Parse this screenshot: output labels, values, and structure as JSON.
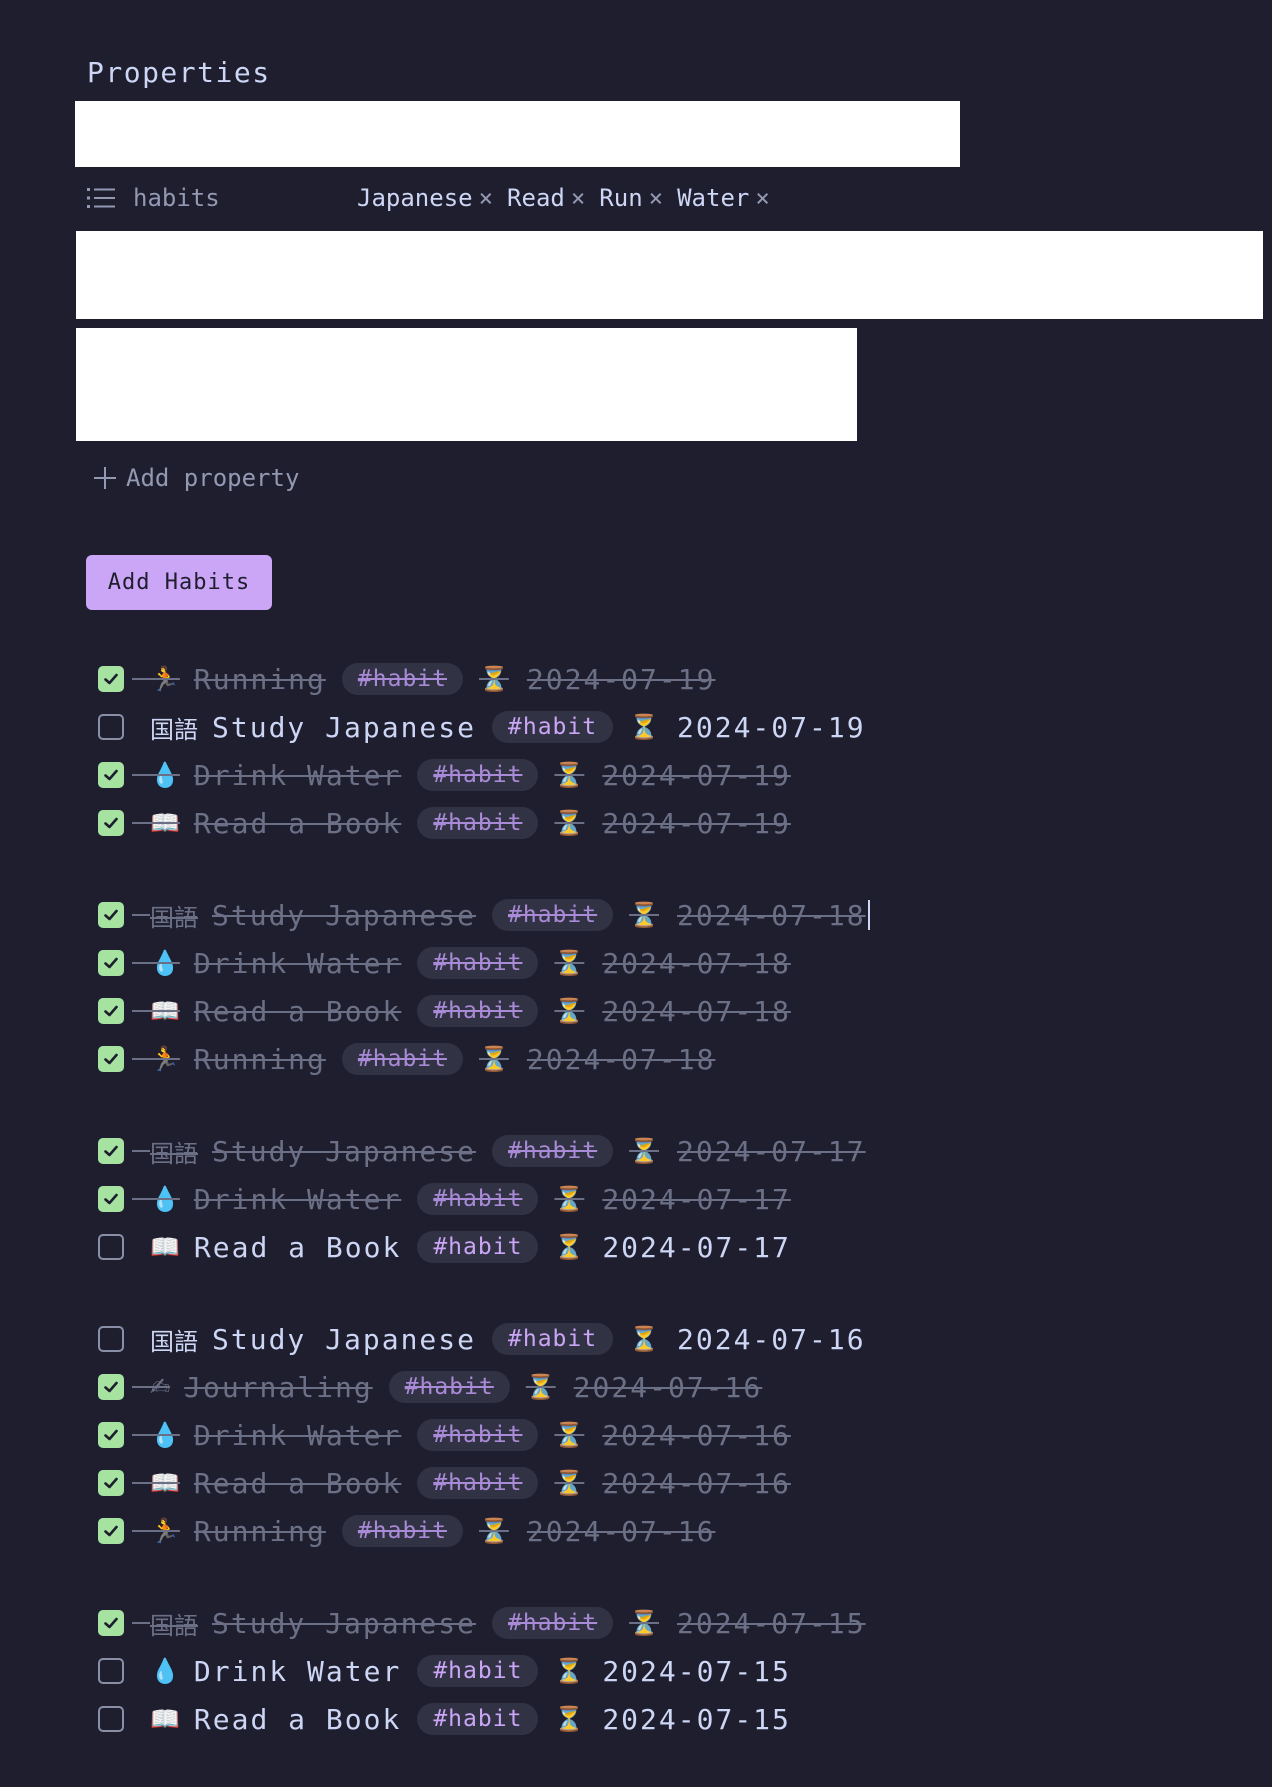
{
  "properties": {
    "title": "Properties",
    "habits_key": "habits",
    "habits_values": [
      "Japanese",
      "Read",
      "Run",
      "Water"
    ],
    "remove_glyph": "×",
    "add_property": "Add property"
  },
  "add_habits_button": "Add Habits",
  "tag_label": "#habit",
  "hourglass": "⏳",
  "groups": [
    {
      "tasks": [
        {
          "done": true,
          "emoji": "🏃",
          "name": "Running",
          "date": "2024-07-19"
        },
        {
          "done": false,
          "emoji": "国語",
          "name": "Study Japanese",
          "date": "2024-07-19"
        },
        {
          "done": true,
          "emoji": "💧",
          "name": "Drink Water",
          "date": "2024-07-19"
        },
        {
          "done": true,
          "emoji": "📖",
          "name": "Read a Book",
          "date": "2024-07-19"
        }
      ]
    },
    {
      "tasks": [
        {
          "done": true,
          "emoji": "国語",
          "name": "Study Japanese",
          "date": "2024-07-18",
          "caret": true
        },
        {
          "done": true,
          "emoji": "💧",
          "name": "Drink Water",
          "date": "2024-07-18"
        },
        {
          "done": true,
          "emoji": "📖",
          "name": "Read a Book",
          "date": "2024-07-18"
        },
        {
          "done": true,
          "emoji": "🏃",
          "name": "Running",
          "date": "2024-07-18"
        }
      ]
    },
    {
      "tasks": [
        {
          "done": true,
          "emoji": "国語",
          "name": "Study Japanese",
          "date": "2024-07-17"
        },
        {
          "done": true,
          "emoji": "💧",
          "name": "Drink Water",
          "date": "2024-07-17"
        },
        {
          "done": false,
          "emoji": "📖",
          "name": "Read a Book",
          "date": "2024-07-17"
        }
      ]
    },
    {
      "tasks": [
        {
          "done": false,
          "emoji": "国語",
          "name": "Study Japanese",
          "date": "2024-07-16"
        },
        {
          "done": true,
          "emoji": "✍",
          "name": "Journaling",
          "date": "2024-07-16"
        },
        {
          "done": true,
          "emoji": "💧",
          "name": "Drink Water",
          "date": "2024-07-16"
        },
        {
          "done": true,
          "emoji": "📖",
          "name": "Read a Book",
          "date": "2024-07-16"
        },
        {
          "done": true,
          "emoji": "🏃",
          "name": "Running",
          "date": "2024-07-16"
        }
      ]
    },
    {
      "tasks": [
        {
          "done": true,
          "emoji": "国語",
          "name": "Study Japanese",
          "date": "2024-07-15"
        },
        {
          "done": false,
          "emoji": "💧",
          "name": "Drink Water",
          "date": "2024-07-15"
        },
        {
          "done": false,
          "emoji": "📖",
          "name": "Read a Book",
          "date": "2024-07-15"
        }
      ]
    }
  ],
  "colors": {
    "background": "#1e1e2e",
    "accent": "#cba6f7",
    "checked": "#a6e3a1",
    "muted": "#6c7086",
    "text": "#cdd6f4"
  }
}
